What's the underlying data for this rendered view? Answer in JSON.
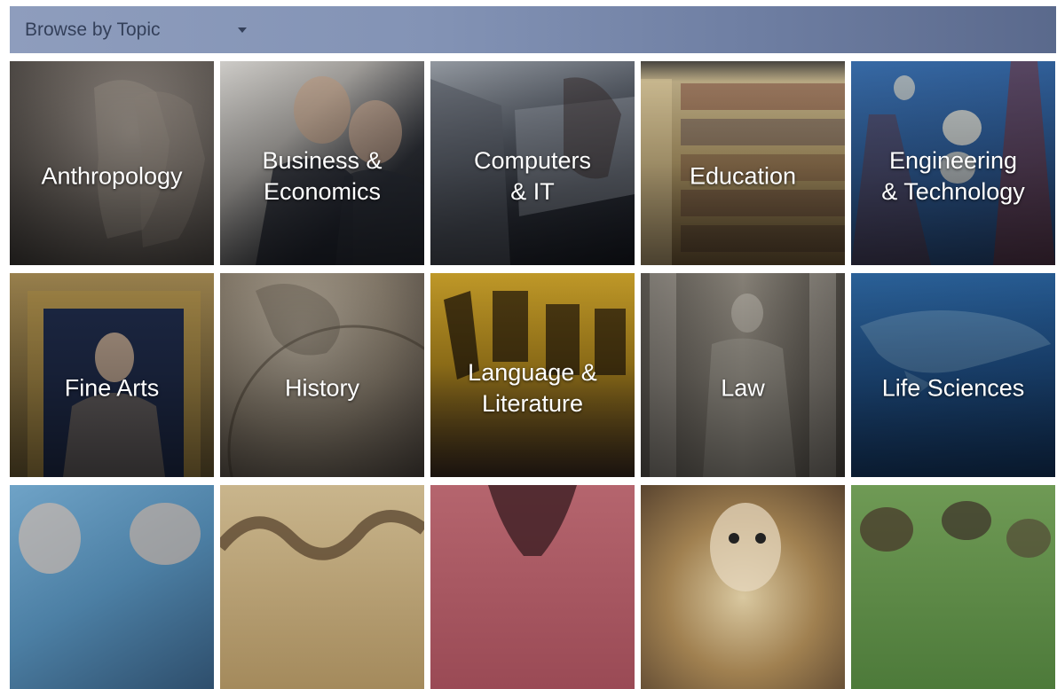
{
  "topic_bar": {
    "selected": "Browse by Topic"
  },
  "tiles": [
    {
      "label": "Anthropology"
    },
    {
      "label": "Business &\nEconomics"
    },
    {
      "label": "Computers\n& IT"
    },
    {
      "label": "Education"
    },
    {
      "label": "Engineering\n& Technology"
    },
    {
      "label": "Fine Arts"
    },
    {
      "label": "History"
    },
    {
      "label": "Language &\nLiterature"
    },
    {
      "label": "Law"
    },
    {
      "label": "Life Sciences"
    }
  ]
}
